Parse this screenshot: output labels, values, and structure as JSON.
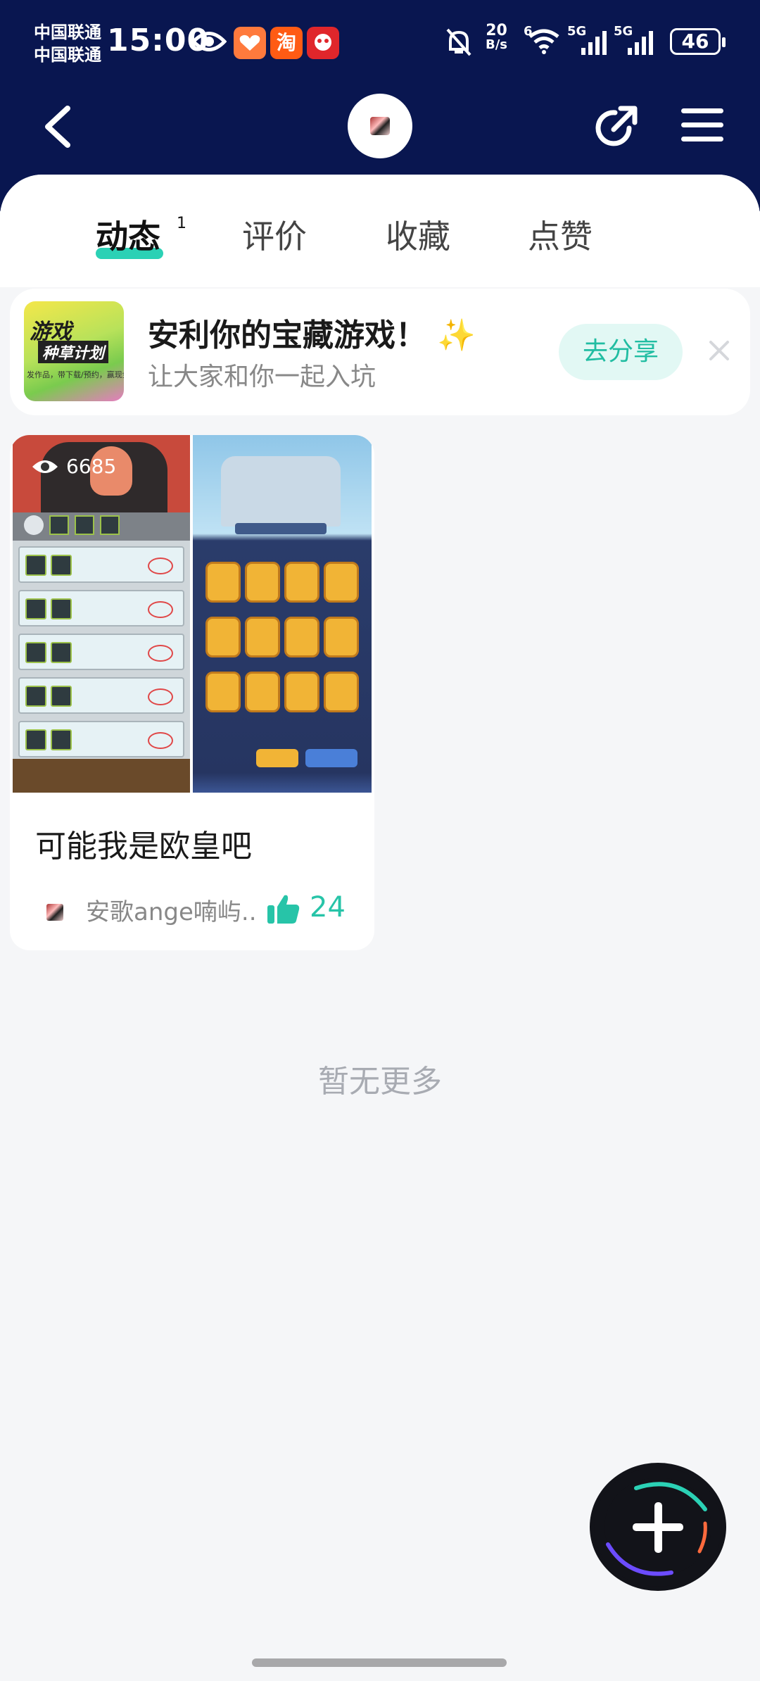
{
  "status_bar": {
    "carrier_1": "中国联通",
    "carrier_2": "中国联通",
    "time": "15:00",
    "net_speed_value": "20",
    "net_speed_unit": "B/s",
    "wifi_label": "6",
    "signal_1_label": "5G",
    "signal_2_label": "5G",
    "battery": "46",
    "app_icon_3": "淘"
  },
  "nav": {
    "back_icon": "chevron-left-icon",
    "share_icon": "share-arrow-icon",
    "menu_icon": "hamburger-menu-icon"
  },
  "tabs": [
    {
      "label": "动态",
      "badge": "1",
      "active": true
    },
    {
      "label": "评价",
      "active": false
    },
    {
      "label": "收藏",
      "active": false
    },
    {
      "label": "点赞",
      "active": false
    }
  ],
  "banner": {
    "thumb_title": "游戏",
    "thumb_subtitle": "种草计划",
    "thumb_caption": "发作品，带下载/预约，赢现金",
    "title": "安利你的宝藏游戏！",
    "sparkle": "✨",
    "subtitle": "让大家和你一起入坑",
    "action_label": "去分享"
  },
  "post": {
    "views": "6685",
    "title": "可能我是欧皇吧",
    "author": "安歌ange喃屿...",
    "likes": "24"
  },
  "footer_text": "暂无更多",
  "colors": {
    "header_bg": "#091650",
    "accent": "#2bd1b5",
    "like": "#27c4a8"
  }
}
